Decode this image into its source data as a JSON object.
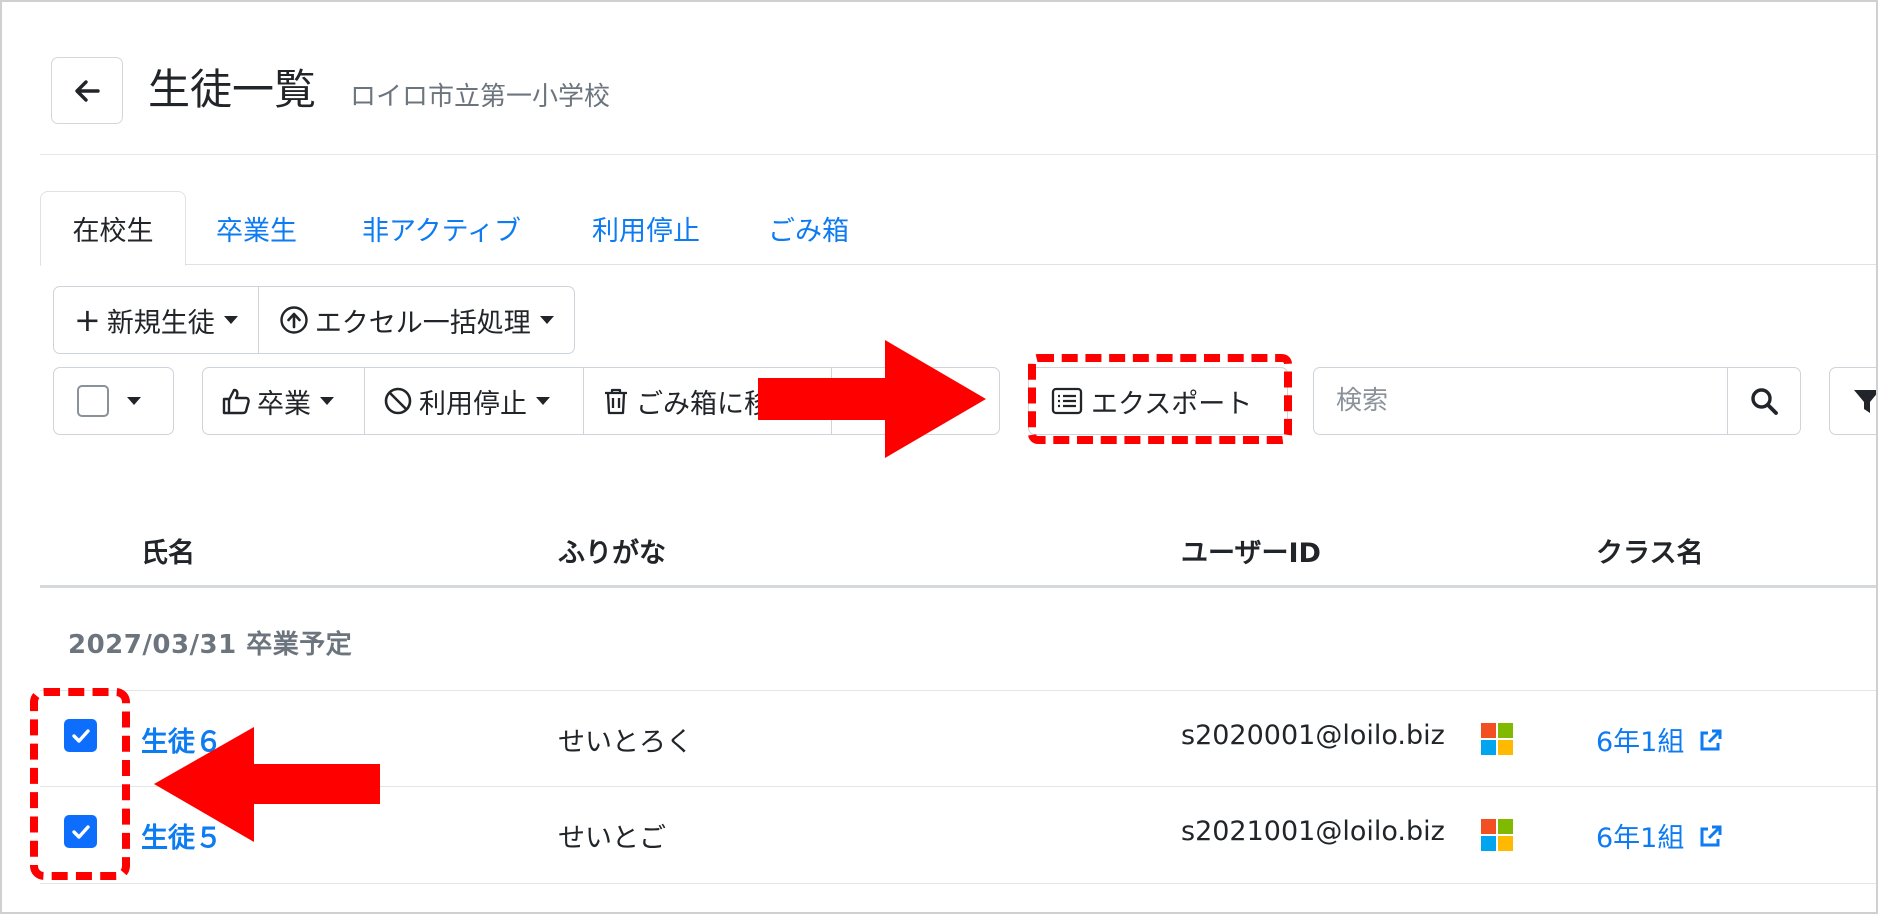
{
  "header": {
    "back_icon": "arrow-left-icon",
    "title": "生徒一覧",
    "subtitle": "ロイロ市立第一小学校"
  },
  "tabs": [
    {
      "label": "在校生",
      "active": true
    },
    {
      "label": "卒業生",
      "active": false
    },
    {
      "label": "非アクティブ",
      "active": false
    },
    {
      "label": "利用停止",
      "active": false
    },
    {
      "label": "ごみ箱",
      "active": false
    }
  ],
  "toolbar": {
    "new_student_label": "新規生徒",
    "excel_batch_label": "エクセル一括処理",
    "graduate_label": "卒業",
    "suspend_label": "利用停止",
    "trash_label": "ごみ箱に移",
    "export_label": "エクスポート",
    "search_placeholder": "検索"
  },
  "table": {
    "columns": [
      "氏名",
      "ふりがな",
      "ユーザーID",
      "クラス名"
    ],
    "group_label": "2027/03/31 卒業予定",
    "rows": [
      {
        "checked": true,
        "name": "生徒６",
        "furigana": "せいとろく",
        "user_id": "s2020001@loilo.biz",
        "account_icon": "microsoft-icon",
        "class_name": "6年1組"
      },
      {
        "checked": true,
        "name": "生徒５",
        "furigana": "せいとご",
        "user_id": "s2021001@loilo.biz",
        "account_icon": "microsoft-icon",
        "class_name": "6年1組"
      }
    ]
  },
  "colors": {
    "link": "#0d7bf2",
    "checkbox": "#0d6efd",
    "annotation": "#ff0000"
  }
}
